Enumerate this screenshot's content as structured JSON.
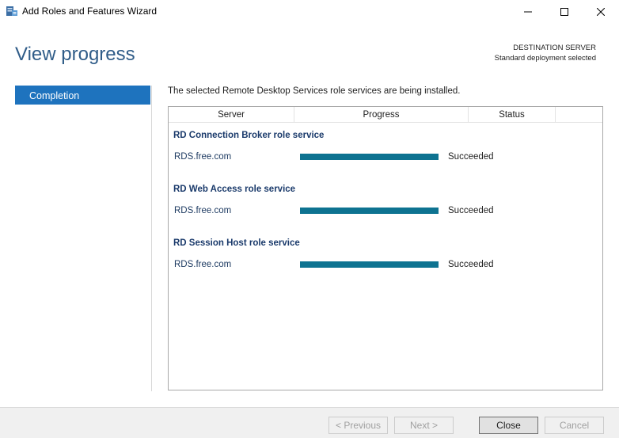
{
  "window": {
    "title": "Add Roles and Features Wizard",
    "icon": "server-manager-icon"
  },
  "header": {
    "page_title": "View progress",
    "destination_label": "DESTINATION SERVER",
    "destination_value": "Standard deployment selected"
  },
  "nav": {
    "items": [
      {
        "label": "Completion",
        "selected": true
      }
    ]
  },
  "main": {
    "intro": "The selected Remote Desktop Services role services are being installed.",
    "columns": [
      "Server",
      "Progress",
      "Status"
    ],
    "groups": [
      {
        "title": "RD Connection Broker role service",
        "server": "RDS.free.com",
        "progress": 1.0,
        "status": "Succeeded"
      },
      {
        "title": "RD Web Access role service",
        "server": "RDS.free.com",
        "progress": 1.0,
        "status": "Succeeded"
      },
      {
        "title": "RD Session Host role service",
        "server": "RDS.free.com",
        "progress": 1.0,
        "status": "Succeeded"
      }
    ]
  },
  "footer": {
    "previous_label": "< Previous",
    "next_label": "Next >",
    "close_label": "Close",
    "cancel_label": "Cancel"
  },
  "colors": {
    "accent": "#1e73be",
    "title": "#2f5c88",
    "progress": "#0e7391"
  }
}
